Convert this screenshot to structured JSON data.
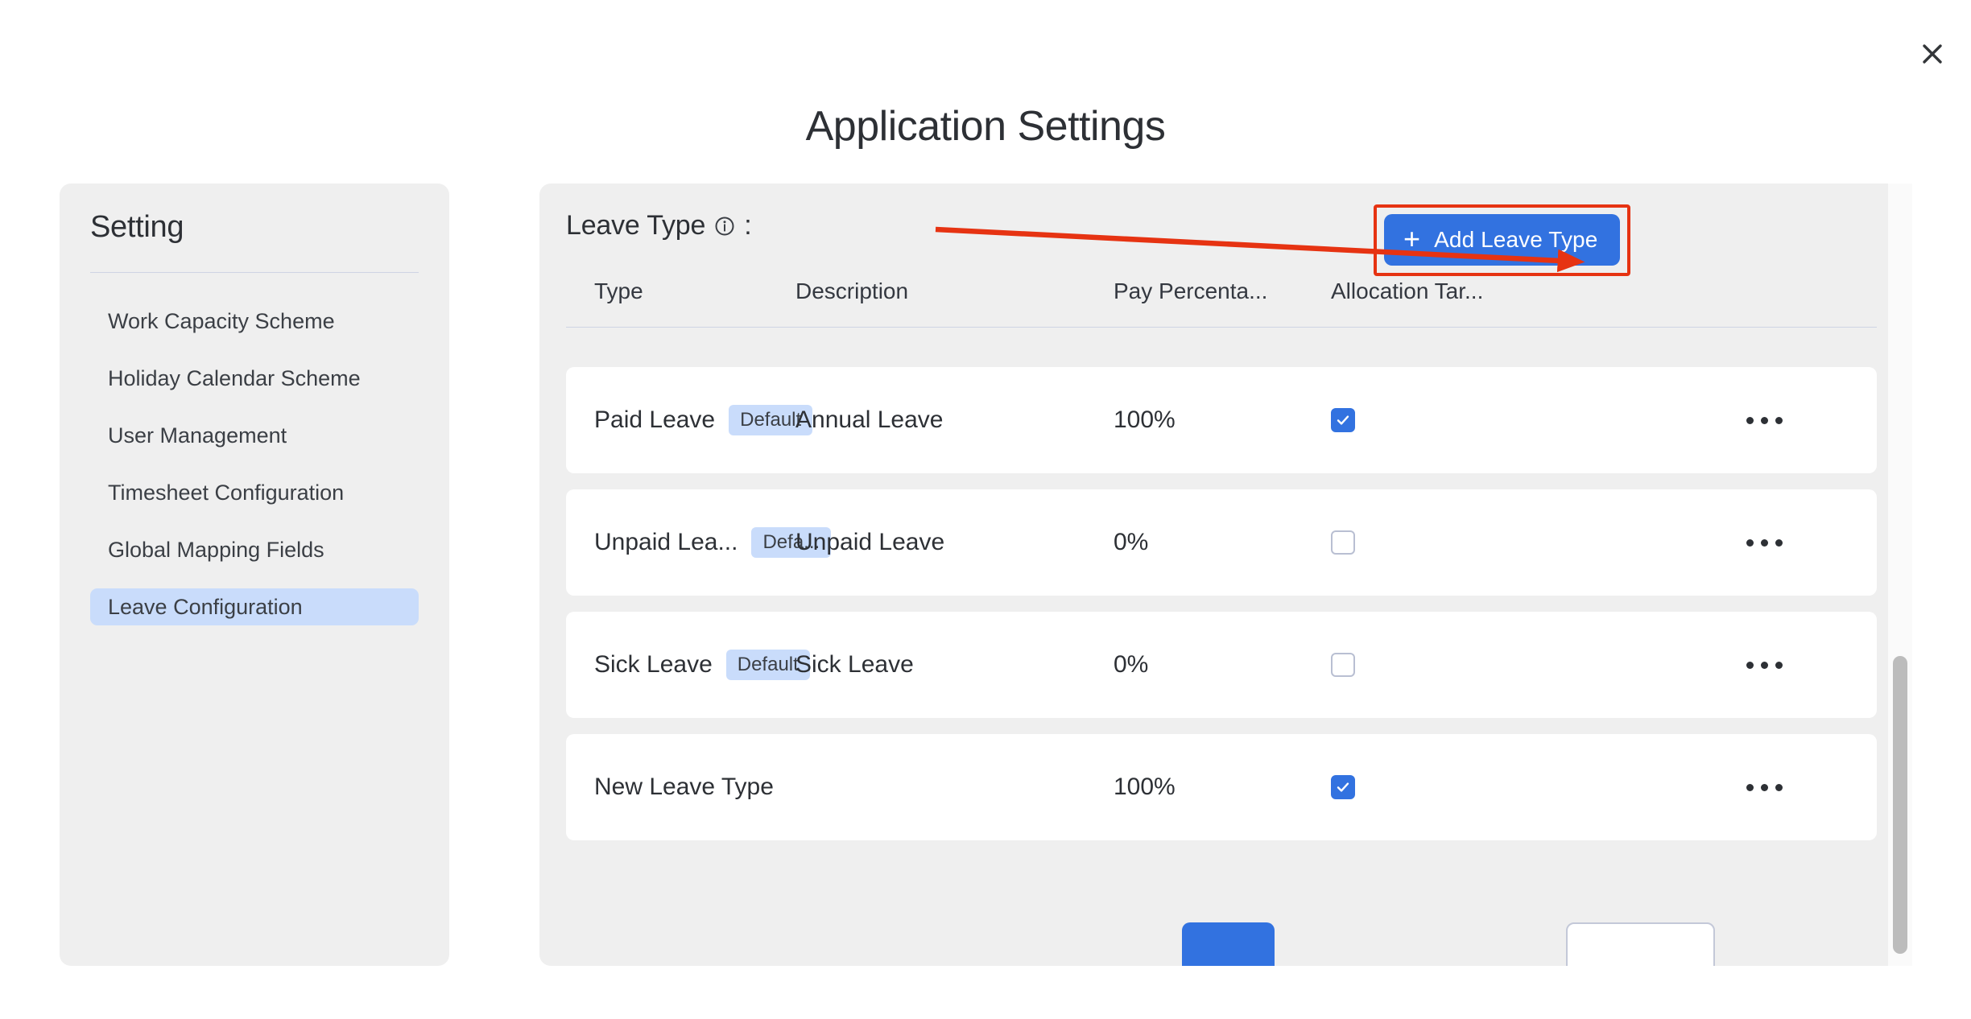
{
  "window": {
    "title": "Application Settings",
    "close_icon": "close-icon"
  },
  "sidebar": {
    "title": "Setting",
    "items": [
      {
        "label": "Work Capacity Scheme",
        "active": false
      },
      {
        "label": "Holiday Calendar Scheme",
        "active": false
      },
      {
        "label": "User Management",
        "active": false
      },
      {
        "label": "Timesheet Configuration",
        "active": false
      },
      {
        "label": "Global Mapping Fields",
        "active": false
      },
      {
        "label": "Leave Configuration",
        "active": true
      }
    ]
  },
  "main": {
    "section_title": "Leave Type",
    "section_title_suffix": ":",
    "info_icon": "info-circle-icon",
    "add_button": {
      "label": "Add Leave Type",
      "plus_icon": "plus-icon",
      "highlighted": true,
      "highlight_color": "#e63312",
      "background_color": "#3272e0"
    },
    "table": {
      "columns": [
        "Type",
        "Description",
        "Pay Percenta...",
        "Allocation Tar..."
      ],
      "rows": [
        {
          "type": "Paid Leave",
          "badge": "Default",
          "description": "Annual Leave",
          "pay_percentage": "100%",
          "allocation_target": true,
          "menu_icon": "ellipsis-icon"
        },
        {
          "type": "Unpaid Lea...",
          "badge": "Defa...",
          "description": "Unpaid Leave",
          "pay_percentage": "0%",
          "allocation_target": false,
          "menu_icon": "ellipsis-icon"
        },
        {
          "type": "Sick Leave",
          "badge": "Default",
          "description": "Sick Leave",
          "pay_percentage": "0%",
          "allocation_target": false,
          "menu_icon": "ellipsis-icon"
        },
        {
          "type": "New Leave Type",
          "badge": "",
          "description": "",
          "pay_percentage": "100%",
          "allocation_target": true,
          "menu_icon": "ellipsis-icon"
        }
      ]
    },
    "footer": {
      "primary_label": "",
      "secondary_label": ""
    }
  },
  "scrollbar": {
    "name": "vertical-scrollbar"
  },
  "annotation": {
    "arrow_color": "#e63312",
    "points_to": "Add Leave Type"
  }
}
